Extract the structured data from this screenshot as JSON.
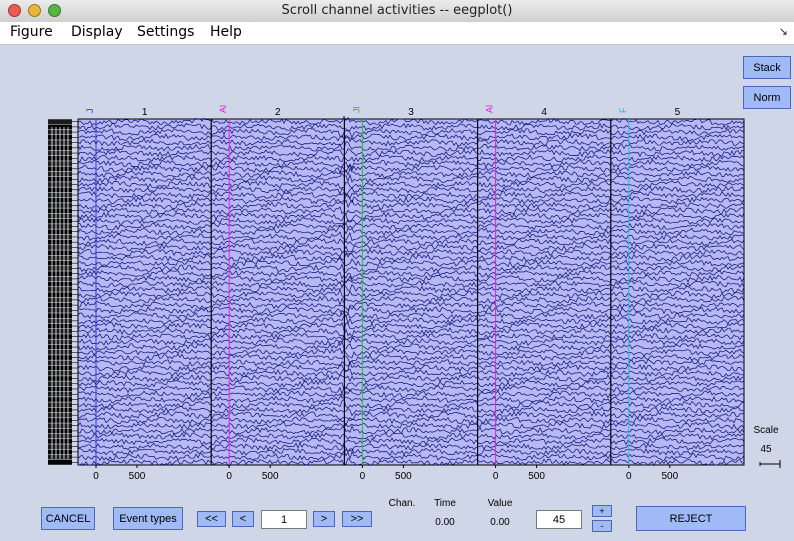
{
  "window": {
    "title": "Scroll channel activities -- eegplot()"
  },
  "menu": {
    "items": [
      "Figure",
      "Display",
      "Settings",
      "Help"
    ]
  },
  "side_buttons": {
    "stack": "Stack",
    "norm": "Norm"
  },
  "epochs": {
    "labels": [
      "1",
      "2",
      "3",
      "4",
      "5"
    ],
    "events": [
      {
        "epoch": 1,
        "label": "J",
        "color": "#2a3ae0"
      },
      {
        "epoch": 2,
        "label": "Al",
        "color": "#e020e0"
      },
      {
        "epoch": 3,
        "label": "Jl",
        "color": "#22c522"
      },
      {
        "epoch": 4,
        "label": "Al",
        "color": "#e020e0"
      },
      {
        "epoch": 5,
        "label": "F",
        "color": "#22b8e0"
      }
    ],
    "tick_labels": [
      "0",
      "500"
    ]
  },
  "plot": {
    "background": "#b7b9f5",
    "trace_color": "#0a0a6e",
    "channel_count": 66
  },
  "scale": {
    "label": "Scale",
    "value": "45"
  },
  "bottom": {
    "cancel": "CANCEL",
    "event_types": "Event types",
    "nav_first": "<<",
    "nav_prev": "<",
    "epoch_value": "1",
    "nav_next": ">",
    "nav_last": ">>",
    "chan_label": "Chan.",
    "time_label": "Time",
    "time_value": "0.00",
    "value_label": "Value",
    "value_value": "0.00",
    "scale_value": "45",
    "plus": "+",
    "minus": "-",
    "reject": "REJECT"
  }
}
